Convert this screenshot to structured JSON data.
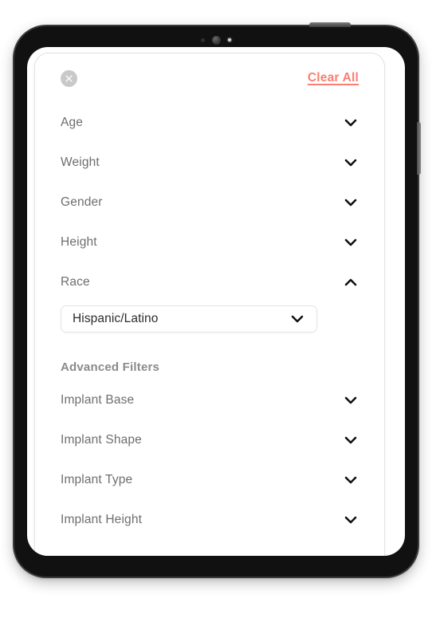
{
  "device": {
    "type": "tablet-mockup",
    "sensors": [
      "proximity-sensor",
      "front-camera",
      "ambient-light-sensor"
    ],
    "side_button": "power-button",
    "top_button": "volume-button"
  },
  "card": {
    "header": {
      "close_icon": "close-x-icon",
      "clear_all_label": "Clear All",
      "clear_all_color": "#fb7e72"
    },
    "primary_filters": [
      {
        "label": "Age",
        "expanded": false,
        "chevron": "chevron-down-icon"
      },
      {
        "label": "Weight",
        "expanded": false,
        "chevron": "chevron-down-icon"
      },
      {
        "label": "Gender",
        "expanded": false,
        "chevron": "chevron-down-icon"
      },
      {
        "label": "Height",
        "expanded": false,
        "chevron": "chevron-down-icon"
      },
      {
        "label": "Race",
        "expanded": true,
        "chevron": "chevron-up-icon"
      }
    ],
    "race_select": {
      "value": "Hispanic/Latino",
      "chevron": "chevron-down-icon"
    },
    "advanced": {
      "heading": "Advanced  Filters",
      "filters": [
        {
          "label": "Implant Base",
          "expanded": false,
          "chevron": "chevron-down-icon"
        },
        {
          "label": "Implant Shape",
          "expanded": false,
          "chevron": "chevron-down-icon"
        },
        {
          "label": "Implant Type",
          "expanded": false,
          "chevron": "chevron-down-icon"
        },
        {
          "label": "Implant Height",
          "expanded": false,
          "chevron": "chevron-down-icon"
        }
      ]
    }
  },
  "colors": {
    "label_text": "#6e6e6e",
    "heading_text": "#8a8a8a",
    "value_text": "#2b2b2b",
    "accent": "#fb7e72",
    "chevron": "#111111",
    "card_border": "#e2e2e2",
    "close_button_bg": "#c9c9c9"
  }
}
